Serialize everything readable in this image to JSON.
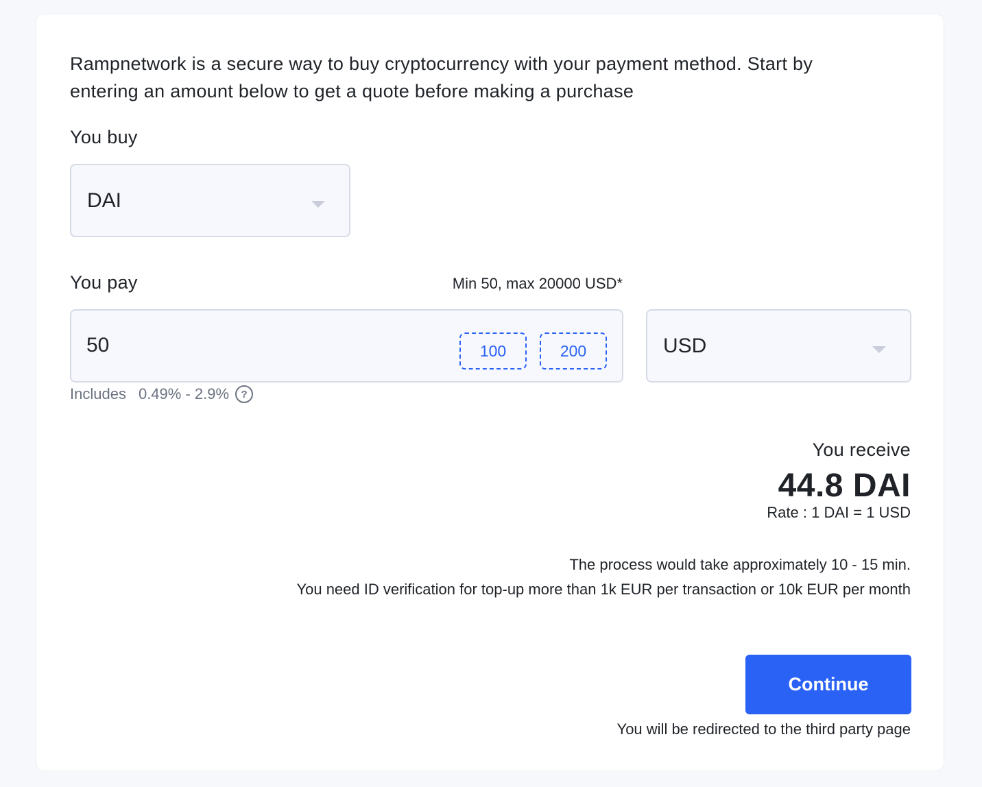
{
  "intro_text": "Rampnetwork is a secure way to buy cryptocurrency with your payment method. Start by entering an amount below to get a quote before making a purchase",
  "buy": {
    "label": "You buy",
    "selected_asset": "DAI"
  },
  "pay": {
    "label": "You pay",
    "limits": "Min 50, max 20000 USD*",
    "amount": "50",
    "quick_amounts": [
      "100",
      "200"
    ],
    "currency": "USD",
    "fee_label": "Includes",
    "fee_range": "0.49% - 2.9%",
    "help_glyph": "?"
  },
  "receive": {
    "label": "You receive",
    "amount": "44.8 DAI",
    "rate": "Rate : 1 DAI = 1 USD"
  },
  "info": {
    "process_time": "The process would take approximately 10 - 15 min.",
    "id_verification": "You need ID verification for top-up more than 1k EUR per transaction or 10k EUR per month"
  },
  "actions": {
    "continue_label": "Continue",
    "redirect_note": "You will be redirected to the third party page"
  },
  "colors": {
    "accent": "#2962f5",
    "muted_text": "#6b7280",
    "input_bg": "#f7f8fd",
    "input_border": "#d7dbe6"
  },
  "icons": {
    "dropdown": "chevron-down-icon",
    "help": "question-circle-icon"
  }
}
